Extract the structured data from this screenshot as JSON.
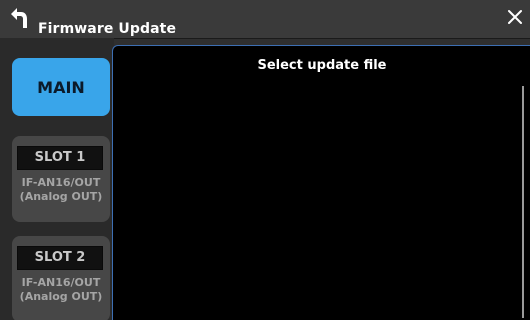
{
  "titlebar": {
    "title": "Firmware Update"
  },
  "icons": {
    "back": "back-arrow-icon",
    "close": "close-icon"
  },
  "sidebar": {
    "main_label": "MAIN",
    "slots": [
      {
        "label": "SLOT 1",
        "subtitle_line1": "IF-AN16/OUT",
        "subtitle_line2": "(Analog OUT)"
      },
      {
        "label": "SLOT 2",
        "subtitle_line1": "IF-AN16/OUT",
        "subtitle_line2": "(Analog OUT)"
      }
    ]
  },
  "panel": {
    "title": "Select update file"
  },
  "colors": {
    "accent": "#39a5ea",
    "panel_border": "#3d6fb3",
    "background": "#2f2f2f"
  }
}
